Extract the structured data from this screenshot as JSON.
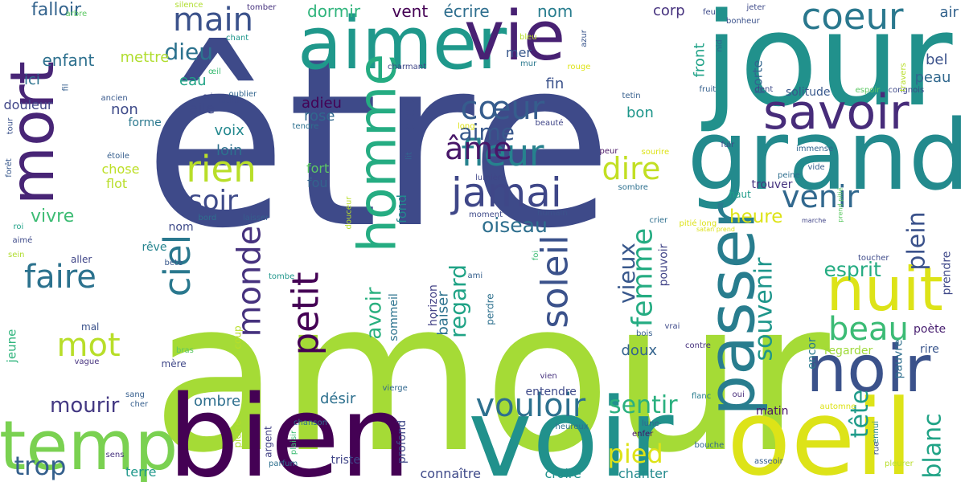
{
  "title": "",
  "words": [
    {
      "text": "amour",
      "color": "#a5db36"
    },
    {
      "text": "être",
      "color": "#3e4a89"
    },
    {
      "text": "jour",
      "color": "#21918c"
    },
    {
      "text": "bien",
      "color": "#440154"
    },
    {
      "text": "voir",
      "color": "#21918c"
    },
    {
      "text": "oeil",
      "color": "#dde318"
    },
    {
      "text": "grand",
      "color": "#238a8d"
    },
    {
      "text": "aimer",
      "color": "#1f988b"
    },
    {
      "text": "vie",
      "color": "#482173"
    },
    {
      "text": "temp",
      "color": "#7ad151"
    },
    {
      "text": "mort",
      "color": "#482576"
    },
    {
      "text": "passer",
      "color": "#287d8e"
    },
    {
      "text": "noir",
      "color": "#3b528b"
    },
    {
      "text": "savoir",
      "color": "#472c7a"
    },
    {
      "text": "nuit",
      "color": "#dde318"
    },
    {
      "text": "homme",
      "color": "#25ac82"
    },
    {
      "text": "coeur",
      "color": "#2a788e"
    },
    {
      "text": "jamai",
      "color": "#3f4788"
    },
    {
      "text": "fleur",
      "color": "#26828e"
    },
    {
      "text": "monde",
      "color": "#46327e"
    },
    {
      "text": "ciel",
      "color": "#2a788e"
    },
    {
      "text": "soleil",
      "color": "#3b528b"
    },
    {
      "text": "vouloir",
      "color": "#2d708e"
    },
    {
      "text": "petit",
      "color": "#440154"
    },
    {
      "text": "faire",
      "color": "#2c728e"
    },
    {
      "text": "cœur",
      "color": "#365d8d"
    },
    {
      "text": "venir",
      "color": "#31688e"
    },
    {
      "text": "rien",
      "color": "#b8de29"
    },
    {
      "text": "main",
      "color": "#3b528b"
    },
    {
      "text": "mot",
      "color": "#b8de29"
    },
    {
      "text": "âme",
      "color": "#481769"
    },
    {
      "text": "dire",
      "color": "#c2df23"
    },
    {
      "text": "beau",
      "color": "#3bbb75"
    },
    {
      "text": "femme",
      "color": "#25ac82"
    },
    {
      "text": "soir",
      "color": "#3e4a89"
    },
    {
      "text": "trop",
      "color": "#35608d"
    },
    {
      "text": "sentir",
      "color": "#2ab07f"
    },
    {
      "text": "pied",
      "color": "#dde318"
    },
    {
      "text": "regard",
      "color": "#20a386"
    },
    {
      "text": "souvenir",
      "color": "#1f968b"
    },
    {
      "text": "plein",
      "color": "#3b528b"
    },
    {
      "text": "tête",
      "color": "#1e9b8a"
    },
    {
      "text": "blanc",
      "color": "#20a386"
    },
    {
      "text": "dieu",
      "color": "#2c728e"
    },
    {
      "text": "aime",
      "color": "#38588c"
    },
    {
      "text": "mourir",
      "color": "#443983"
    },
    {
      "text": "avoir",
      "color": "#2ab07f"
    },
    {
      "text": "vieux",
      "color": "#38588c"
    },
    {
      "text": "oiseau",
      "color": "#2e6f8e"
    },
    {
      "text": "esprit",
      "color": "#25ac82"
    },
    {
      "text": "heure",
      "color": "#dde318"
    },
    {
      "text": "vivre",
      "color": "#3dbc74"
    },
    {
      "text": "falloir",
      "color": "#33638d"
    },
    {
      "text": "enfant",
      "color": "#2d708e"
    },
    {
      "text": "mettre",
      "color": "#b0dd2f"
    },
    {
      "text": "écrire",
      "color": "#2e6e8e"
    },
    {
      "text": "nom",
      "color": "#287d8e"
    },
    {
      "text": "dormir",
      "color": "#2fb47c"
    },
    {
      "text": "vent",
      "color": "#440154"
    },
    {
      "text": "corp",
      "color": "#46327e"
    },
    {
      "text": "air",
      "color": "#33638d"
    },
    {
      "text": "bel",
      "color": "#3b528b"
    },
    {
      "text": "peau",
      "color": "#31688e"
    },
    {
      "text": "ici",
      "color": "#2c728e"
    },
    {
      "text": "eau",
      "color": "#20a386"
    },
    {
      "text": "non",
      "color": "#3e4a89"
    },
    {
      "text": "aile",
      "color": "#3e4989"
    },
    {
      "text": "voix",
      "color": "#23888e"
    },
    {
      "text": "loin",
      "color": "#2d708e"
    },
    {
      "text": "adieu",
      "color": "#440154"
    },
    {
      "text": "rose",
      "color": "#31688e"
    },
    {
      "text": "bruit",
      "color": "#3e4a89"
    },
    {
      "text": "fin",
      "color": "#3b528b"
    },
    {
      "text": "mer",
      "color": "#38588c"
    },
    {
      "text": "bon",
      "color": "#1f968b"
    },
    {
      "text": "front",
      "color": "#1fa287"
    },
    {
      "text": "porte",
      "color": "#32658e"
    },
    {
      "text": "solitude",
      "color": "#38588c"
    },
    {
      "text": "fort",
      "color": "#5cc863"
    },
    {
      "text": "fou",
      "color": "#33638d"
    },
    {
      "text": "fond",
      "color": "#23888e"
    },
    {
      "text": "chose",
      "color": "#bddf26"
    },
    {
      "text": "flot",
      "color": "#b8de29"
    },
    {
      "text": "douleur",
      "color": "#404688"
    },
    {
      "text": "forme",
      "color": "#2a788e"
    },
    {
      "text": "trouver",
      "color": "#46337f"
    },
    {
      "text": "haut",
      "color": "#1e9c89"
    },
    {
      "text": "prendre",
      "color": "#3f4889"
    },
    {
      "text": "pouvoir",
      "color": "#414487"
    },
    {
      "text": "doux",
      "color": "#33638d"
    },
    {
      "text": "poète",
      "color": "#481f70"
    },
    {
      "text": "rire",
      "color": "#39558c"
    },
    {
      "text": "encor",
      "color": "#29798e"
    },
    {
      "text": "regarder",
      "color": "#9fda3a"
    },
    {
      "text": "pauvre",
      "color": "#2e6e8e"
    },
    {
      "text": "baiser",
      "color": "#2c728e"
    },
    {
      "text": "sommeil",
      "color": "#2c738e"
    },
    {
      "text": "désir",
      "color": "#2d708e"
    },
    {
      "text": "ombre",
      "color": "#2e6f8e"
    },
    {
      "text": "rêve",
      "color": "#25848e"
    },
    {
      "text": "nom",
      "color": "#3e4a89"
    },
    {
      "text": "jeune",
      "color": "#2fb47c"
    },
    {
      "text": "entendre",
      "color": "#3e4a89"
    },
    {
      "text": "terre",
      "color": "#1f988b"
    },
    {
      "text": "chanter",
      "color": "#238a8d"
    },
    {
      "text": "croire",
      "color": "#21918c"
    },
    {
      "text": "connaître",
      "color": "#3e4989"
    },
    {
      "text": "triste",
      "color": "#404688"
    },
    {
      "text": "matin",
      "color": "#471365"
    },
    {
      "text": "mal",
      "color": "#3b528b"
    },
    {
      "text": "aller",
      "color": "#404688"
    },
    {
      "text": "coup",
      "color": "#b8de29"
    },
    {
      "text": "horizon",
      "color": "#424186"
    },
    {
      "text": "perdre",
      "color": "#2d708e"
    },
    {
      "text": "profond",
      "color": "#3f4788"
    },
    {
      "text": "argent",
      "color": "#424186"
    },
    {
      "text": "pierre",
      "color": "#b0dd2f"
    },
    {
      "text": "plaisir",
      "color": "#3dbc74"
    },
    {
      "text": "chanson",
      "color": "#2d708e"
    },
    {
      "text": "vierge",
      "color": "#31688e"
    },
    {
      "text": "ami",
      "color": "#355f8d"
    },
    {
      "text": "mère",
      "color": "#3f4788"
    },
    {
      "text": "bras",
      "color": "#5cc863"
    },
    {
      "text": "bois",
      "color": "#355e8d"
    },
    {
      "text": "vrai",
      "color": "#3e4a89"
    },
    {
      "text": "contre",
      "color": "#46327e"
    },
    {
      "text": "flanc",
      "color": "#287d8e"
    },
    {
      "text": "oui",
      "color": "#472c7a"
    },
    {
      "text": "automne",
      "color": "#dde318"
    },
    {
      "text": "ennui",
      "color": "#25848e"
    },
    {
      "text": "pleurer",
      "color": "#b8de29"
    },
    {
      "text": "rue",
      "color": "#3b528b"
    },
    {
      "text": "asseoir",
      "color": "#355e8d"
    },
    {
      "text": "bouche",
      "color": "#31688e"
    },
    {
      "text": "lune",
      "color": "#32658e"
    },
    {
      "text": "enfer",
      "color": "#471365"
    },
    {
      "text": "heureux",
      "color": "#2d708e"
    },
    {
      "text": "vien",
      "color": "#46327e"
    },
    {
      "text": "parfum",
      "color": "#2d708e"
    },
    {
      "text": "sens",
      "color": "#46327e"
    },
    {
      "text": "cher",
      "color": "#355e8d"
    },
    {
      "text": "sang",
      "color": "#355e8d"
    },
    {
      "text": "vague",
      "color": "#46327e"
    },
    {
      "text": "tombe",
      "color": "#1f968b"
    },
    {
      "text": "bête",
      "color": "#38588c"
    },
    {
      "text": "sein",
      "color": "#b0dd2f"
    },
    {
      "text": "aimé",
      "color": "#3e4a89"
    },
    {
      "text": "roi",
      "color": "#1fa287"
    },
    {
      "text": "bord",
      "color": "#2e6f8e"
    },
    {
      "text": "laisser",
      "color": "#355e8d"
    },
    {
      "text": "humain",
      "color": "#3b528b"
    },
    {
      "text": "moment",
      "color": "#3e4a89"
    },
    {
      "text": "crier",
      "color": "#2e6f8e"
    },
    {
      "text": "pitié long",
      "color": "#dde318"
    },
    {
      "text": "marche",
      "color": "#414487"
    },
    {
      "text": "sombre",
      "color": "#2d708e"
    },
    {
      "text": "peine",
      "color": "#2e6e8e"
    },
    {
      "text": "immense",
      "color": "#32658e"
    },
    {
      "text": "vide",
      "color": "#355e8d"
    },
    {
      "text": "fuir",
      "color": "#3e4a89"
    },
    {
      "text": "sourire",
      "color": "#dde318"
    },
    {
      "text": "peur",
      "color": "#471365"
    },
    {
      "text": "lumière",
      "color": "#404688"
    },
    {
      "text": "beauté",
      "color": "#404688"
    },
    {
      "text": "tetin",
      "color": "#355e8d"
    },
    {
      "text": "fruit",
      "color": "#35608d"
    },
    {
      "text": "dent",
      "color": "#3e4a89"
    },
    {
      "text": "espoir",
      "color": "#5cc863"
    },
    {
      "text": "congnois",
      "color": "#3e4989"
    },
    {
      "text": "nid",
      "color": "#31688e"
    },
    {
      "text": "bonheur",
      "color": "#3b528b"
    },
    {
      "text": "feu",
      "color": "#3e4a89"
    },
    {
      "text": "jeter",
      "color": "#3e4a89"
    },
    {
      "text": "bleu",
      "color": "#b8de29"
    },
    {
      "text": "rouge",
      "color": "#dde318"
    },
    {
      "text": "azur",
      "color": "#39558c"
    },
    {
      "text": "mur",
      "color": "#2a788e"
    },
    {
      "text": "charmant",
      "color": "#404688"
    },
    {
      "text": "oublier",
      "color": "#32658e"
    },
    {
      "text": "lourd",
      "color": "#3e4a89"
    },
    {
      "text": "cri",
      "color": "#3e4989"
    },
    {
      "text": "œil",
      "color": "#3dbc74"
    },
    {
      "text": "ancien",
      "color": "#38588c"
    },
    {
      "text": "fil",
      "color": "#355e8d"
    },
    {
      "text": "tour",
      "color": "#3b528b"
    },
    {
      "text": "arbre",
      "color": "#5cc863"
    },
    {
      "text": "silence",
      "color": "#b0dd2f"
    },
    {
      "text": "tomber",
      "color": "#46327e"
    },
    {
      "text": "chant",
      "color": "#1f968b"
    },
    {
      "text": "tendre",
      "color": "#2d708e"
    },
    {
      "text": "étoile",
      "color": "#355e8d"
    },
    {
      "text": "forêt",
      "color": "#38588c"
    },
    {
      "text": "lit",
      "color": "#32658e"
    },
    {
      "text": "long",
      "color": "#dde318"
    },
    {
      "text": "douceur",
      "color": "#b8de29"
    },
    {
      "text": "foi",
      "color": "#3dbc74"
    },
    {
      "text": "prend pitié",
      "color": "#5cc863"
    },
    {
      "text": "satan prend",
      "color": "#dde318"
    },
    {
      "text": "travers",
      "color": "#b8de29"
    },
    {
      "text": "toucher",
      "color": "#3e4a89"
    }
  ]
}
